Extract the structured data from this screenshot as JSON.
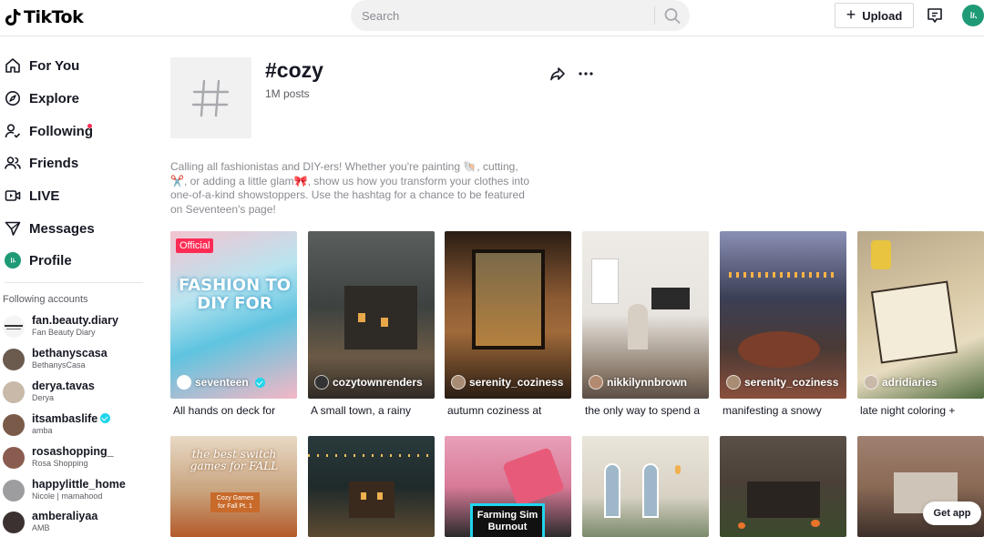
{
  "header": {
    "logo_text": "TikTok",
    "search_placeholder": "Search",
    "upload_label": "Upload"
  },
  "sidebar": {
    "nav": [
      {
        "label": "For You",
        "icon": "home-icon"
      },
      {
        "label": "Explore",
        "icon": "compass-icon"
      },
      {
        "label": "Following",
        "icon": "following-icon"
      },
      {
        "label": "Friends",
        "icon": "friends-icon"
      },
      {
        "label": "LIVE",
        "icon": "live-icon"
      },
      {
        "label": "Messages",
        "icon": "messages-icon"
      },
      {
        "label": "Profile",
        "icon": "profile-avatar"
      }
    ],
    "following_title": "Following accounts",
    "accounts": [
      {
        "username": "fan.beauty.diary",
        "display": "Fan Beauty Diary",
        "verified": false,
        "avatar_color": "#f4f4f4"
      },
      {
        "username": "bethanyscasa",
        "display": "BethanysCasa",
        "verified": false,
        "avatar_color": "#6b5a4e"
      },
      {
        "username": "derya.tavas",
        "display": "Derya",
        "verified": false,
        "avatar_color": "#c9b9a8"
      },
      {
        "username": "itsambaslife",
        "display": "amba",
        "verified": true,
        "avatar_color": "#7a5b4a"
      },
      {
        "username": "rosashopping_",
        "display": "Rosa Shopping",
        "verified": false,
        "avatar_color": "#8a5c4f"
      },
      {
        "username": "happylittle_home",
        "display": "Nicole | mamahood",
        "verified": false,
        "avatar_color": "#9d9da0"
      },
      {
        "username": "amberaliyaa",
        "display": "AMB",
        "verified": false,
        "avatar_color": "#3a3130"
      }
    ]
  },
  "hashtag": {
    "title": "#cozy",
    "posts": "1M posts",
    "description": "Calling all fashionistas and DIY-ers! Whether you're painting 🐚, cutting, ✂️, or adding a little glam🎀, show us how you transform your clothes into one-of-a-kind showstoppers. Use the hashtag for a chance to be featured on Seventeen's page!"
  },
  "videos_row1": [
    {
      "user": "seventeen",
      "caption": "All hands on deck for",
      "official": "Official",
      "overlay_text": "FASHION TO DIY FOR",
      "colors": [
        "#5fc4e0",
        "#f4b7c5"
      ]
    },
    {
      "user": "cozytownrenders",
      "caption": "A small town, a rainy",
      "colors": [
        "#3d4240",
        "#6b5a45"
      ]
    },
    {
      "user": "serenity_coziness",
      "caption": "autumn coziness at",
      "colors": [
        "#3a2a1e",
        "#8b5a33"
      ]
    },
    {
      "user": "nikkilynnbrown",
      "caption": "the only way to spend a",
      "colors": [
        "#e7e4df",
        "#5a4d44"
      ]
    },
    {
      "user": "serenity_coziness",
      "caption": "manifesting a snowy",
      "colors": [
        "#3b3f55",
        "#8a4f3c"
      ]
    },
    {
      "user": "adridiaries",
      "caption": "late night coloring +",
      "colors": [
        "#d9c9a6",
        "#4e6a3d"
      ]
    }
  ],
  "videos_row2": [
    {
      "overlay_text": "the best switch games for FALL",
      "subtext": "Cozy Games for Fall Pt. 1",
      "colors": [
        "#e8d9c5",
        "#b45a2a"
      ]
    },
    {
      "colors": [
        "#1f2a2b",
        "#5c4a32"
      ]
    },
    {
      "overlay_text": "Farming Sim Burnout",
      "colors": [
        "#e8a0b8",
        "#2b2b2b"
      ]
    },
    {
      "colors": [
        "#d8d2c5",
        "#7a8a6a"
      ]
    },
    {
      "colors": [
        "#4a4038",
        "#3b4a2c"
      ]
    },
    {
      "colors": [
        "#8a6a55",
        "#3c2f2a"
      ]
    }
  ],
  "get_app_label": "Get app",
  "accent_color": "#fe2c55"
}
